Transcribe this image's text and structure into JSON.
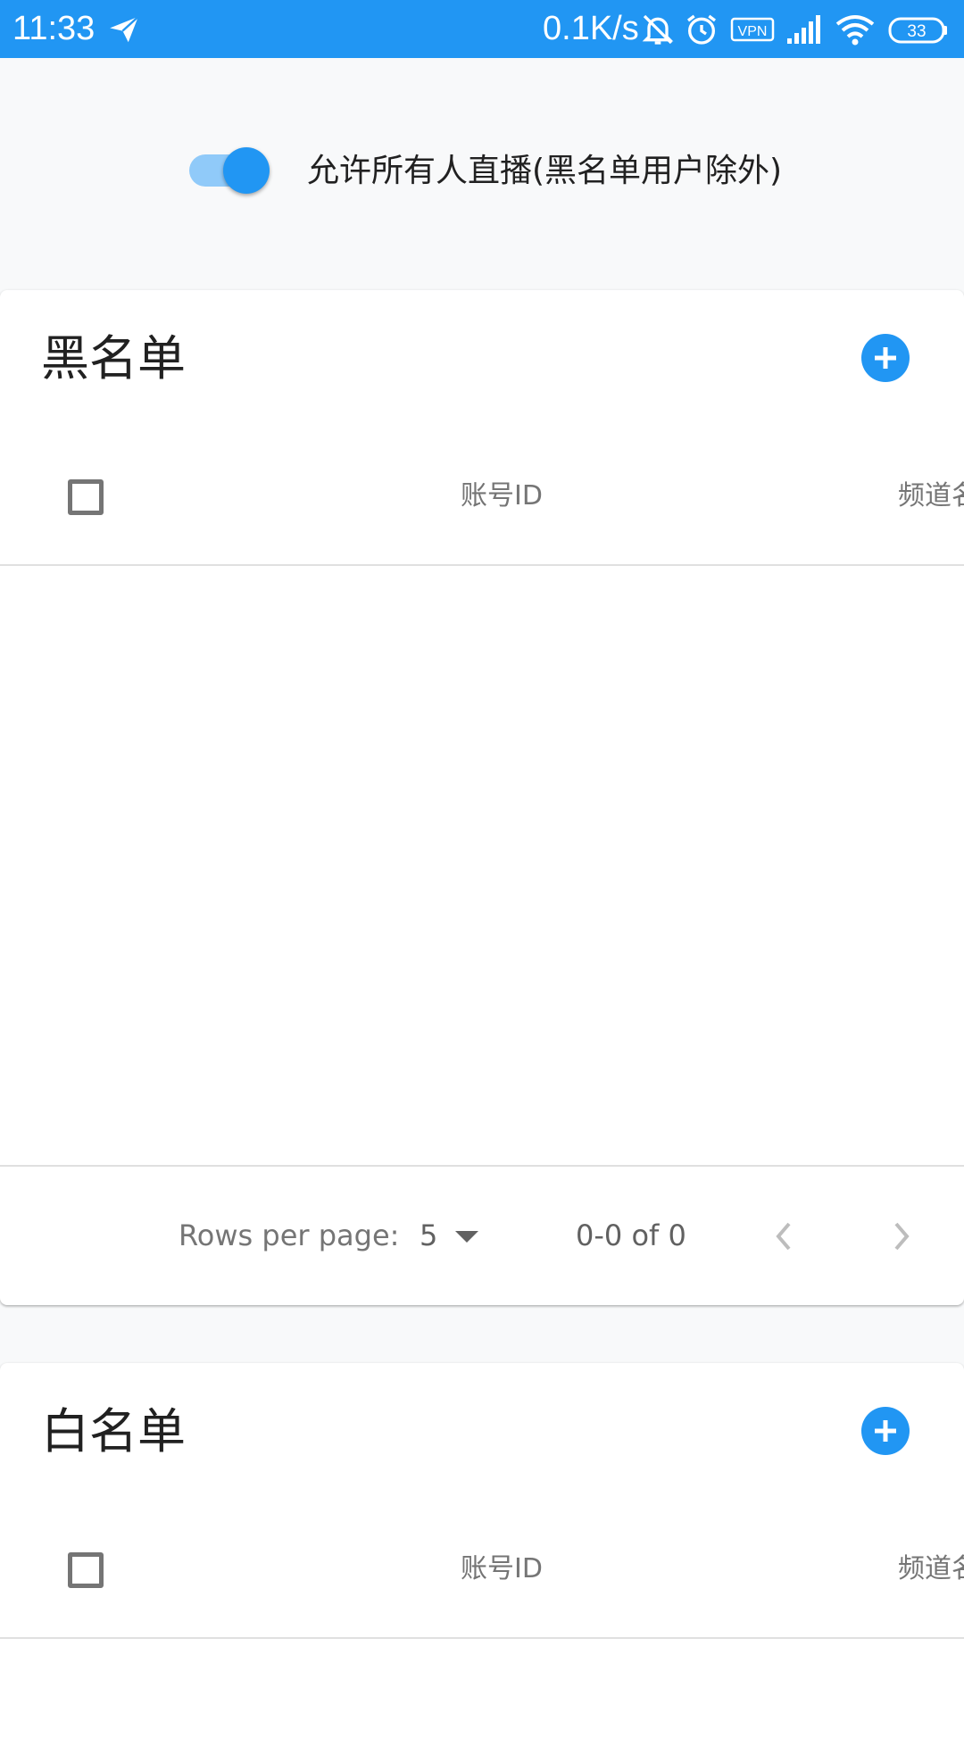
{
  "status_bar": {
    "time": "11:33",
    "net_speed": "0.1K/s",
    "vpn_label": "VPN",
    "battery_level": "33",
    "icons": [
      "telegram-icon",
      "bell-off-icon",
      "alarm-icon",
      "vpn-icon",
      "signal-icon",
      "wifi-icon",
      "battery-icon"
    ]
  },
  "toggle": {
    "label": "允许所有人直播(黑名单用户除外)",
    "checked": true
  },
  "blacklist": {
    "title": "黑名单",
    "columns": [
      "账号ID",
      "频道名"
    ],
    "rows": [],
    "footer": {
      "rows_per_page_label": "Rows per page:",
      "rows_per_page_value": "5",
      "page_range": "0-0 of 0"
    }
  },
  "whitelist": {
    "title": "白名单",
    "columns": [
      "账号ID",
      "频道名"
    ],
    "rows": []
  },
  "colors": {
    "primary": "#2196f3",
    "primary_light": "#90caf9",
    "background": "#f8f9fa",
    "muted_text": "#757575"
  }
}
